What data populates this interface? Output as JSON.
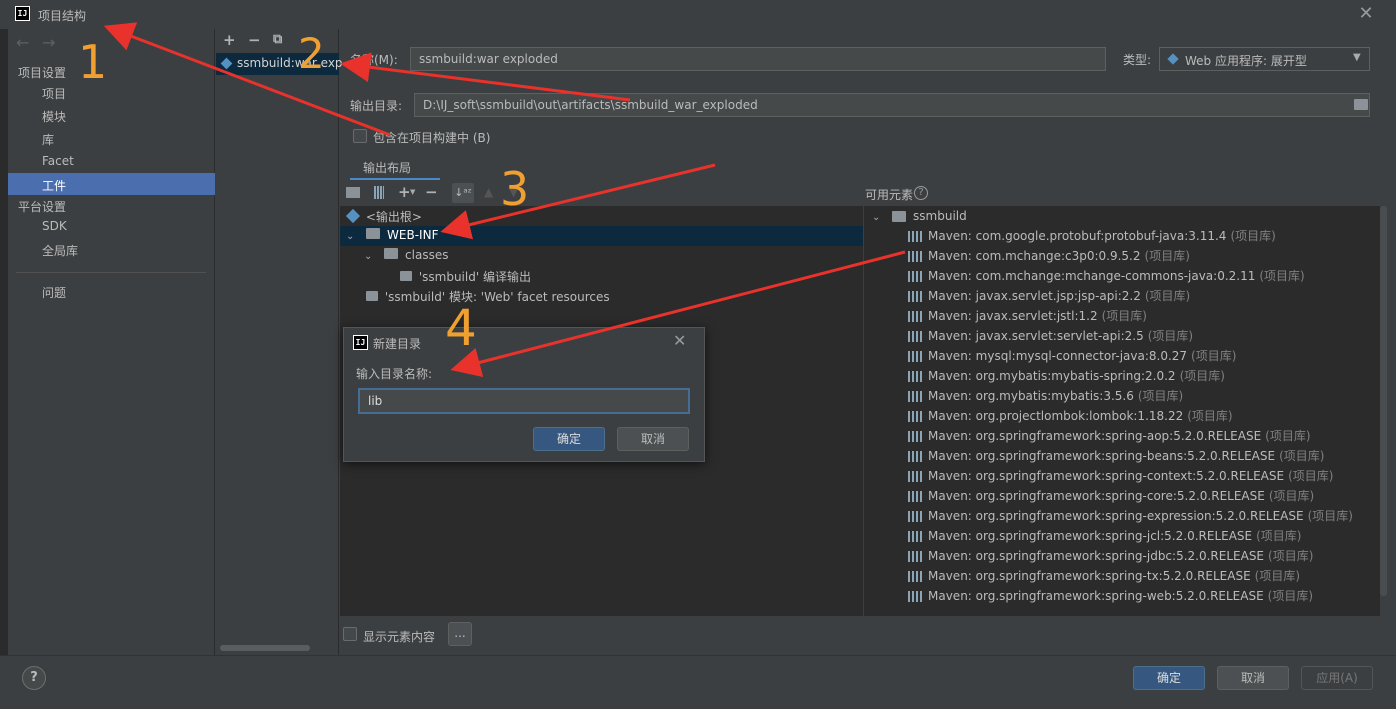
{
  "window": {
    "title": "项目结构"
  },
  "nav": {
    "project_settings": "项目设置",
    "items": [
      "项目",
      "模块",
      "库",
      "Facet",
      "工件"
    ],
    "platform_settings": "平台设置",
    "platform_items": [
      "SDK",
      "全局库"
    ],
    "problems": "问题",
    "selected": "工件"
  },
  "artifacts": {
    "toolbar": {
      "add": "+",
      "remove": "−",
      "copy": "⧉"
    },
    "items": [
      "ssmbuild:war exp"
    ]
  },
  "form": {
    "name_label": "名称(M):",
    "name_value": "ssmbuild:war exploded",
    "type_label": "类型:",
    "type_value": "Web 应用程序: 展开型",
    "output_dir_label": "输出目录:",
    "output_dir_value": "D:\\IJ_soft\\ssmbuild\\out\\artifacts\\ssmbuild_war_exploded",
    "include_build_label": "包含在项目构建中 (B)",
    "output_layout_tab": "输出布局",
    "available_elements_label": "可用元素",
    "show_content_label": "显示元素内容",
    "more_btn": "..."
  },
  "layout_tree": {
    "root": "<输出根>",
    "webinf": "WEB-INF",
    "classes": "classes",
    "compile_output": "'ssmbuild' 编译输出",
    "facet_resources": "'ssmbuild' 模块: 'Web' facet resources"
  },
  "available": {
    "root": "ssmbuild",
    "tag": "(项目库)",
    "libs": [
      "Maven: com.google.protobuf:protobuf-java:3.11.4",
      "Maven: com.mchange:c3p0:0.9.5.2",
      "Maven: com.mchange:mchange-commons-java:0.2.11",
      "Maven: javax.servlet.jsp:jsp-api:2.2",
      "Maven: javax.servlet:jstl:1.2",
      "Maven: javax.servlet:servlet-api:2.5",
      "Maven: mysql:mysql-connector-java:8.0.27",
      "Maven: org.mybatis:mybatis-spring:2.0.2",
      "Maven: org.mybatis:mybatis:3.5.6",
      "Maven: org.projectlombok:lombok:1.18.22",
      "Maven: org.springframework:spring-aop:5.2.0.RELEASE",
      "Maven: org.springframework:spring-beans:5.2.0.RELEASE",
      "Maven: org.springframework:spring-context:5.2.0.RELEASE",
      "Maven: org.springframework:spring-core:5.2.0.RELEASE",
      "Maven: org.springframework:spring-expression:5.2.0.RELEASE",
      "Maven: org.springframework:spring-jcl:5.2.0.RELEASE",
      "Maven: org.springframework:spring-jdbc:5.2.0.RELEASE",
      "Maven: org.springframework:spring-tx:5.2.0.RELEASE",
      "Maven: org.springframework:spring-web:5.2.0.RELEASE"
    ]
  },
  "dialog": {
    "title": "新建目录",
    "prompt": "输入目录名称:",
    "value": "lib",
    "ok": "确定",
    "cancel": "取消"
  },
  "footer": {
    "help": "?",
    "ok": "确定",
    "cancel": "取消",
    "apply": "应用(A)"
  },
  "annotations": {
    "n1": "1",
    "n2": "2",
    "n3": "3",
    "n4": "4"
  },
  "colors": {
    "accent": "#4b6eaf",
    "annotation_red": "#e8322b",
    "annotation_orange": "#f0a030"
  }
}
